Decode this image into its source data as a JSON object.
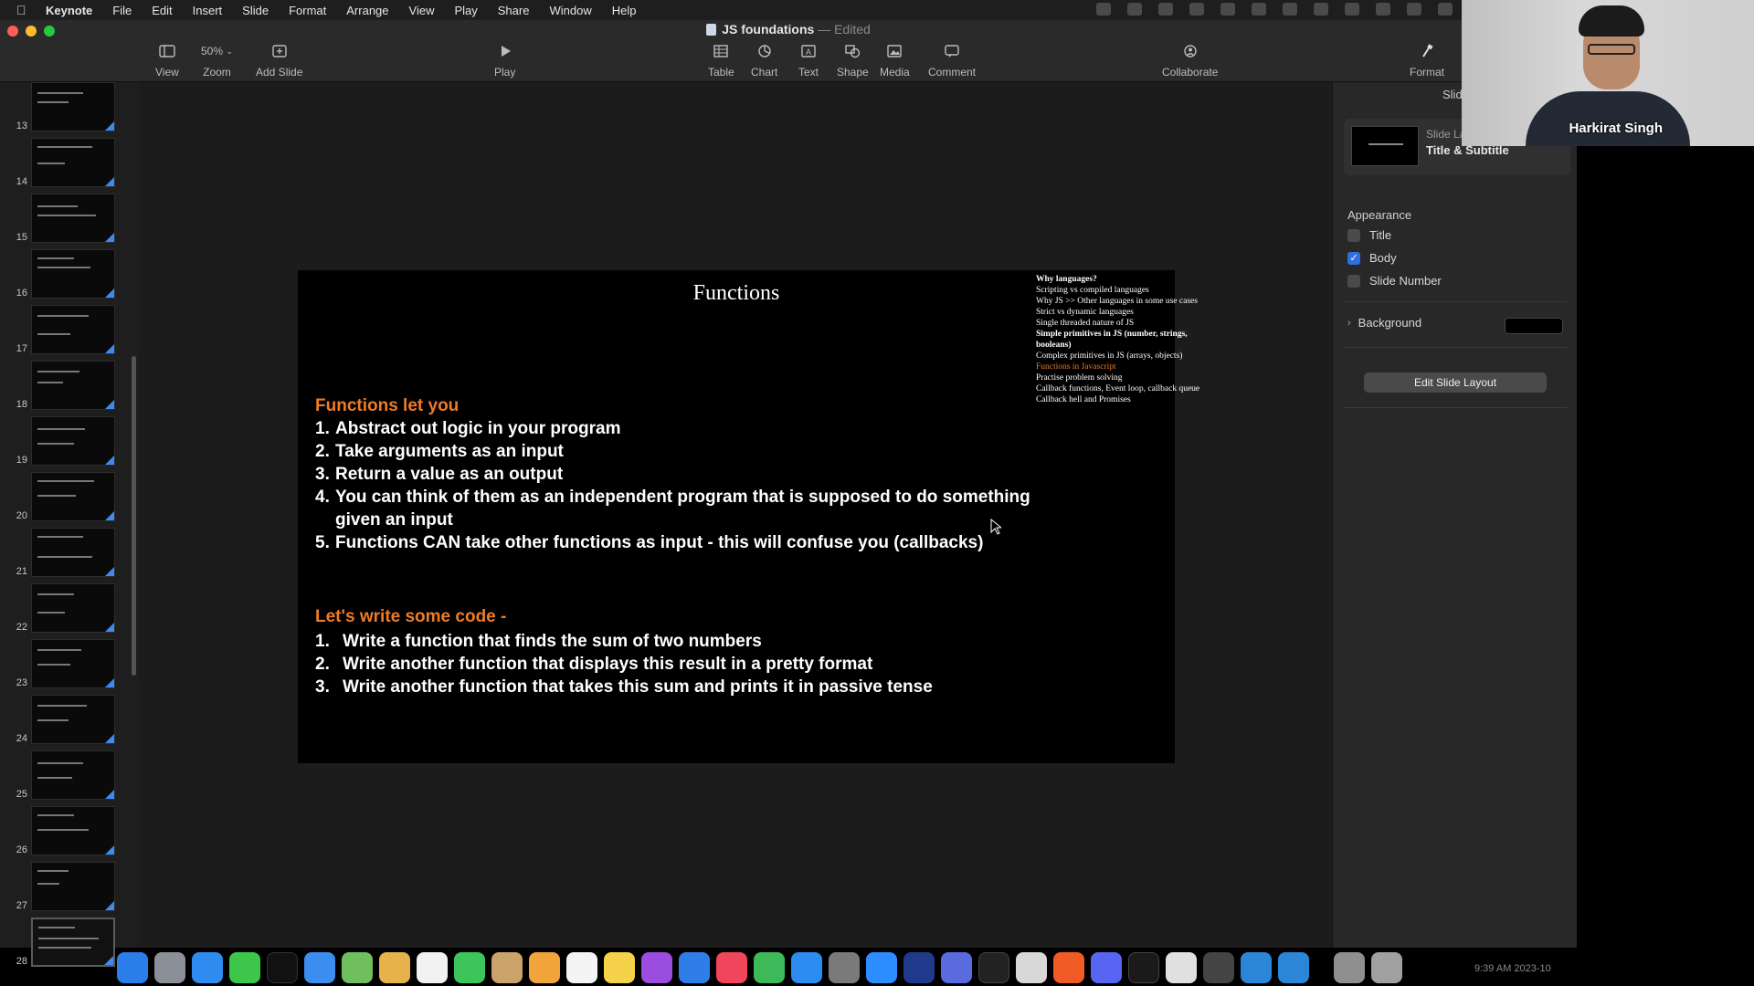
{
  "menubar": {
    "app": "Keynote",
    "items": [
      "File",
      "Edit",
      "Insert",
      "Slide",
      "Format",
      "Arrange",
      "View",
      "Play",
      "Share",
      "Window",
      "Help"
    ]
  },
  "window": {
    "title": "JS foundations",
    "title_sep": "—",
    "title_status": "Edited"
  },
  "toolbar": {
    "view": "View",
    "zoom_value": "50%",
    "zoom": "Zoom",
    "add_slide": "Add Slide",
    "play": "Play",
    "table": "Table",
    "chart": "Chart",
    "text": "Text",
    "shape": "Shape",
    "media": "Media",
    "comment": "Comment",
    "collaborate": "Collaborate",
    "format": "Format"
  },
  "navigator": {
    "slide_numbers": [
      "13",
      "14",
      "15",
      "16",
      "17",
      "18",
      "19",
      "20",
      "21",
      "22",
      "23",
      "24",
      "25",
      "26",
      "27",
      "28"
    ],
    "selected": "28"
  },
  "slide": {
    "title": "Functions",
    "toc": [
      {
        "text": "Why languages?",
        "style": "b"
      },
      {
        "text": "Scripting vs compiled languages",
        "style": ""
      },
      {
        "text": "Why JS >> Other languages in some use cases",
        "style": ""
      },
      {
        "text": "Strict vs dynamic languages",
        "style": ""
      },
      {
        "text": "Single threaded nature of JS",
        "style": ""
      },
      {
        "text": "Simple primitives in JS (number, strings,",
        "style": "b"
      },
      {
        "text": "booleans)",
        "style": "b"
      },
      {
        "text": "Complex primitives in JS (arrays, objects)",
        "style": ""
      },
      {
        "text": "Functions in Javascript",
        "style": "hl"
      },
      {
        "text": "Practise problem solving",
        "style": ""
      },
      {
        "text": "Callback functions, Event loop, callback queue",
        "style": ""
      },
      {
        "text": "Callback hell and Promises",
        "style": ""
      }
    ],
    "section1": {
      "heading": "Functions let you",
      "items": [
        {
          "num": "1.",
          "text": "Abstract out logic in your program"
        },
        {
          "num": "2.",
          "text": "Take arguments as an input"
        },
        {
          "num": "3.",
          "text": "Return a value as an output"
        },
        {
          "num": "4.",
          "text": "You can think of them as an independent program that is supposed to do something"
        },
        {
          "num": "",
          "text": "given an input"
        },
        {
          "num": "5.",
          "text": "Functions CAN take other functions as input - this will confuse you (callbacks)"
        }
      ]
    },
    "section2": {
      "heading": "Let's write some code -",
      "items": [
        {
          "num": "1.",
          "text": "Write a function that finds the sum of two numbers"
        },
        {
          "num": "2.",
          "text": "Write another function that displays this result in a pretty format"
        },
        {
          "num": "3.",
          "text": "Write another function that takes this sum and prints it in passive tense"
        }
      ]
    }
  },
  "format_panel": {
    "tab": "Slide",
    "layout_label": "Slide Layout",
    "layout_name": "Title & Subtitle",
    "appearance": "Appearance",
    "options": [
      {
        "label": "Title",
        "checked": false
      },
      {
        "label": "Body",
        "checked": true
      },
      {
        "label": "Slide Number",
        "checked": false
      }
    ],
    "background": "Background",
    "edit_layout": "Edit Slide Layout"
  },
  "webcam": {
    "name": "Harkirat Singh"
  },
  "dock": {
    "time": "9:39 AM",
    "date": "2023-10"
  },
  "colors": {
    "accent": "#ee7b26",
    "selection": "#2f6fde",
    "thumb_corner": "#3d8bf0"
  }
}
